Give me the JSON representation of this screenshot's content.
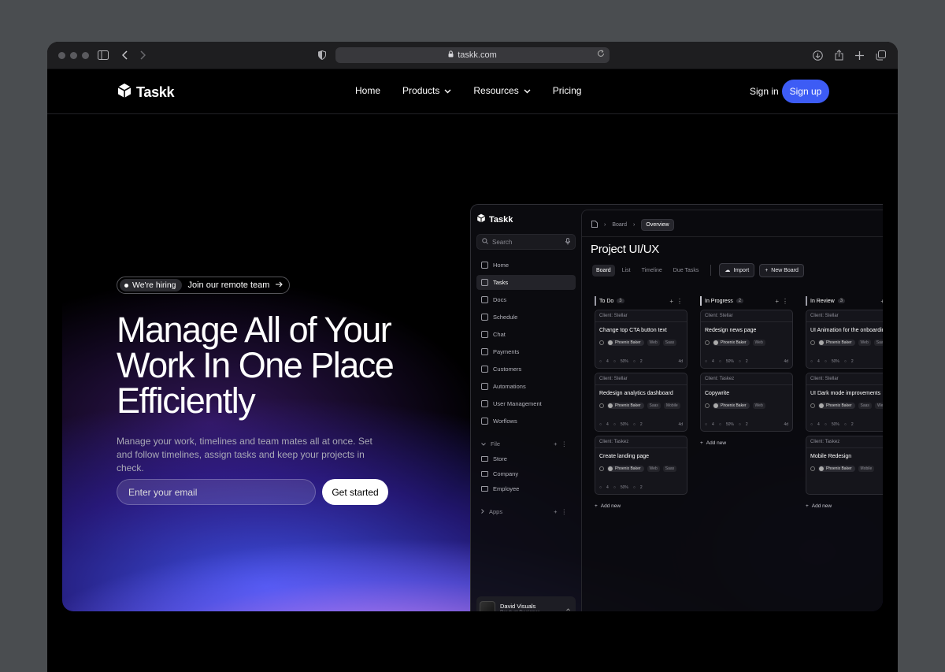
{
  "browser": {
    "url": "taskk.com"
  },
  "nav": {
    "logo": "Taskk",
    "links": [
      {
        "label": "Home"
      },
      {
        "label": "Products"
      },
      {
        "label": "Resources"
      },
      {
        "label": "Pricing"
      }
    ],
    "signin": "Sign in",
    "signup": "Sign up"
  },
  "hero": {
    "badge_pill": "We're hiring",
    "badge_text": "Join our remote team",
    "headline": [
      "Manage All of Your",
      "Work In One Place",
      "Efficiently"
    ],
    "sub": "Manage your work, timelines and team mates all at once. Set and follow timelines, assign tasks and keep your projects in check.",
    "email_placeholder": "Enter your email",
    "cta": "Get started"
  },
  "app": {
    "logo": "Taskk",
    "search_placeholder": "Search",
    "menu": [
      "Home",
      "Tasks",
      "Docs",
      "Schedule",
      "Chat",
      "Payments",
      "Customers",
      "Automations",
      "User Management",
      "Worflows"
    ],
    "active_menu": "Tasks",
    "file_header": "File",
    "files": [
      "Store",
      "Company",
      "Employee"
    ],
    "apps_header": "Apps",
    "user": {
      "name": "David Visuals",
      "role": "Product Designer"
    },
    "breadcrumb": [
      "Board",
      "Overview"
    ],
    "project_title": "Project UI/UX",
    "tabs": [
      "Board",
      "List",
      "Timeline",
      "Due Tasks"
    ],
    "import_label": "Import",
    "new_board_label": "New Board",
    "add_new": "Add new",
    "columns": [
      {
        "name": "To Do",
        "count": "3",
        "cards": [
          {
            "client": "Client: Stellar",
            "title": "Change top CTA button text",
            "owner": "Phoenix Baker",
            "tags": [
              "Web",
              "Saas"
            ],
            "meta": [
              "4",
              "50%",
              "2"
            ],
            "date": "4d"
          },
          {
            "client": "Client: Stellar",
            "title": "Redesign analytics dashboard",
            "owner": "Phoenix Baker",
            "tags": [
              "Saas",
              "Mobile"
            ],
            "meta": [
              "4",
              "50%",
              "2"
            ],
            "date": "4d"
          },
          {
            "client": "Client: Taskez",
            "title": "Create landing page",
            "owner": "Phoenix Baker",
            "tags": [
              "Web",
              "Saas"
            ],
            "meta": [
              "4",
              "50%",
              "2"
            ],
            "date": ""
          }
        ]
      },
      {
        "name": "In Progress",
        "count": "2",
        "cards": [
          {
            "client": "Client: Stellar",
            "title": "Redesign news page",
            "owner": "Phoenix Baker",
            "tags": [
              "Web"
            ],
            "meta": [
              "4",
              "50%",
              "2"
            ],
            "date": "4d"
          },
          {
            "client": "Client: Taskez",
            "title": "Copywrite",
            "owner": "Phoenix Baker",
            "tags": [
              "Web"
            ],
            "meta": [
              "4",
              "50%",
              "2"
            ],
            "date": "4d"
          }
        ]
      },
      {
        "name": "In Review",
        "count": "3",
        "cards": [
          {
            "client": "Client: Stellar",
            "title": "UI Animation for the onboarding",
            "owner": "Phoenix Baker",
            "tags": [
              "Web",
              "Saas"
            ],
            "meta": [
              "4",
              "50%",
              "2"
            ],
            "date": ""
          },
          {
            "client": "Client: Stellar",
            "title": "UI Dark mode improvements",
            "owner": "Phoenix Baker",
            "tags": [
              "Saas",
              "Web"
            ],
            "meta": [
              "4",
              "50%",
              "2"
            ],
            "date": ""
          },
          {
            "client": "Client: Taskez",
            "title": "Mobile Redesign",
            "owner": "Phoenix Baker",
            "tags": [
              "Mobile"
            ],
            "meta": [],
            "date": ""
          }
        ]
      }
    ]
  }
}
